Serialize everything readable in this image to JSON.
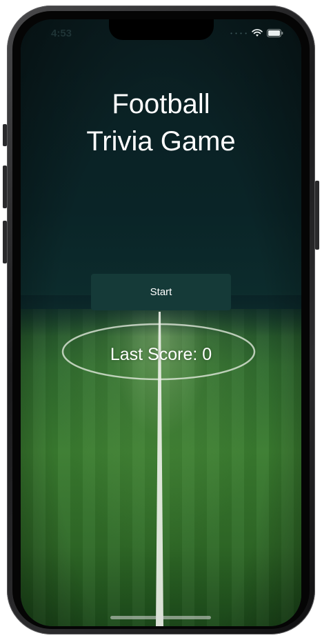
{
  "status_bar": {
    "time": "4:53",
    "signal_icon": "cellular-dots-icon",
    "wifi_icon": "wifi-icon",
    "battery_icon": "battery-icon"
  },
  "main": {
    "title_line1": "Football",
    "title_line2": "Trivia Game",
    "start_label": "Start",
    "last_score_text": "Last Score: 0"
  },
  "colors": {
    "background_top": "#0a2427",
    "button_bg": "#153a38",
    "text": "#ffffff",
    "grass": "#3a7c2f"
  }
}
